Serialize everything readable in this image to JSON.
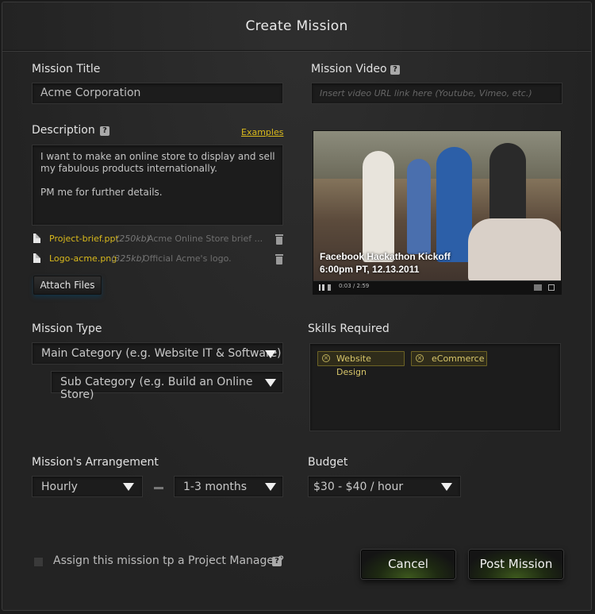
{
  "header": {
    "title": "Create Mission"
  },
  "mission_title": {
    "label": "Mission Title",
    "value": "Acme Corporation"
  },
  "mission_video": {
    "label": "Mission Video",
    "help": "?",
    "placeholder": "Insert video URL link here (Youtube, Vimeo, etc.)",
    "caption_line1": "Facebook Hackathon Kickoff",
    "caption_line2": "6:00pm PT, 12.13.2011",
    "time": "0:03 / 2:59"
  },
  "description": {
    "label": "Description",
    "help": "?",
    "examples_link": "Examples",
    "text": "I want to make an online store to display and sell my fabulous products internationally.\n\nPM me for further details."
  },
  "attachments": [
    {
      "name": "Project-brief.ppt",
      "size": "(250kb)",
      "desc": "Acme Online Store brief ..."
    },
    {
      "name": "Logo-acme.png",
      "size": "(325kb)",
      "desc": "Official Acme's logo."
    }
  ],
  "attach_button": "Attach Files",
  "mission_type": {
    "label": "Mission Type",
    "main_category": "Main Category (e.g. Website IT & Software)",
    "sub_category": "Sub Category (e.g. Build an Online Store)"
  },
  "skills": {
    "label": "Skills Required",
    "tags": [
      "Website Design",
      "eCommerce"
    ],
    "remove_glyph": "×"
  },
  "arrangement": {
    "label": "Mission's Arrangement",
    "type": "Hourly",
    "duration": "1-3 months"
  },
  "budget": {
    "label": "Budget",
    "value": "$30 - $40 / hour"
  },
  "assign_pm": {
    "label": "Assign this mission tp a Project Manager?",
    "help": "?"
  },
  "buttons": {
    "cancel": "Cancel",
    "post": "Post Mission"
  }
}
